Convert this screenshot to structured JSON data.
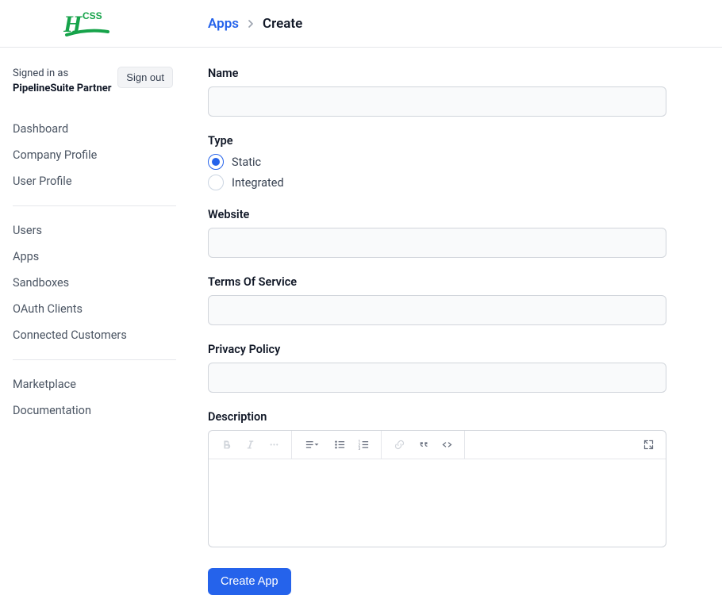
{
  "header": {
    "logo_text_h": "H",
    "logo_text_css": "CSS"
  },
  "breadcrumb": {
    "link": "Apps",
    "current": "Create"
  },
  "user": {
    "signed_in_as": "Signed in as",
    "name": "PipelineSuite Partner",
    "sign_out": "Sign out"
  },
  "nav": {
    "group1": [
      "Dashboard",
      "Company Profile",
      "User Profile"
    ],
    "group2": [
      "Users",
      "Apps",
      "Sandboxes",
      "OAuth Clients",
      "Connected Customers"
    ],
    "group3": [
      "Marketplace",
      "Documentation"
    ]
  },
  "form": {
    "name_label": "Name",
    "name_value": "",
    "type_label": "Type",
    "type_options": {
      "static": "Static",
      "integrated": "Integrated"
    },
    "type_selected": "static",
    "website_label": "Website",
    "website_value": "",
    "tos_label": "Terms Of Service",
    "tos_value": "",
    "privacy_label": "Privacy Policy",
    "privacy_value": "",
    "description_label": "Description",
    "submit": "Create App"
  }
}
